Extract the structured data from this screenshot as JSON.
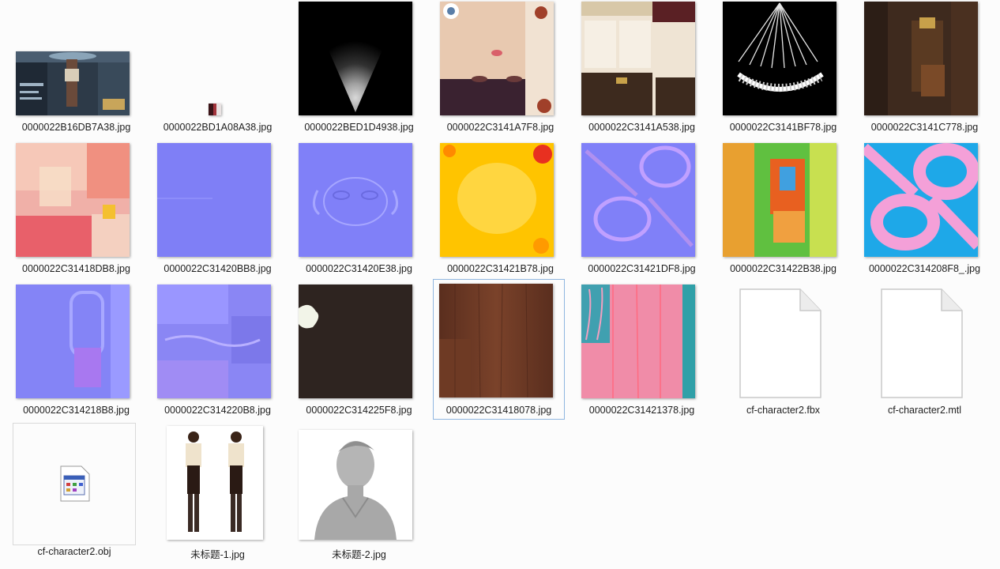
{
  "files": [
    {
      "name": "0000022B16DB7A38.jpg",
      "kind": "game-screenshot"
    },
    {
      "name": "0000022BD1A08A38.jpg",
      "kind": "tiny-strip"
    },
    {
      "name": "0000022BED1D4938.jpg",
      "kind": "light-cone"
    },
    {
      "name": "0000022C3141A7F8.jpg",
      "kind": "face-texture"
    },
    {
      "name": "0000022C3141A538.jpg",
      "kind": "clothing-texture"
    },
    {
      "name": "0000022C3141BF78.jpg",
      "kind": "eyelash-texture"
    },
    {
      "name": "0000022C3141C778.jpg",
      "kind": "leather-texture"
    },
    {
      "name": "0000022C31418DB8.jpg",
      "kind": "pink-map"
    },
    {
      "name": "0000022C31420BB8.jpg",
      "kind": "flat-normal"
    },
    {
      "name": "0000022C31420E38.jpg",
      "kind": "face-normal"
    },
    {
      "name": "0000022C31421B78.jpg",
      "kind": "yellow-map"
    },
    {
      "name": "0000022C31421DF8.jpg",
      "kind": "glasses-normal"
    },
    {
      "name": "0000022C31422B38.jpg",
      "kind": "green-map"
    },
    {
      "name": "0000022C314208F8_.jpg",
      "kind": "pink-glasses"
    },
    {
      "name": "0000022C314218B8.jpg",
      "kind": "belt-normal"
    },
    {
      "name": "0000022C314220B8.jpg",
      "kind": "cloth-normal"
    },
    {
      "name": "0000022C314225F8.jpg",
      "kind": "dark-texture"
    },
    {
      "name": "0000022C31418078.jpg",
      "kind": "hair-texture"
    },
    {
      "name": "0000022C31421378.jpg",
      "kind": "hair-pink"
    },
    {
      "name": "cf-character2.fbx",
      "kind": "blank-file-icon"
    },
    {
      "name": "cf-character2.mtl",
      "kind": "blank-file-icon"
    },
    {
      "name": "cf-character2.obj",
      "kind": "app-file-icon"
    },
    {
      "name": "未标题-1.jpg",
      "kind": "character-render"
    },
    {
      "name": "未标题-2.jpg",
      "kind": "bust-render"
    }
  ],
  "selected": "0000022C31418078.jpg",
  "colors": {
    "selection_border": "#8fb6e0",
    "background": "#fcfcfc"
  }
}
